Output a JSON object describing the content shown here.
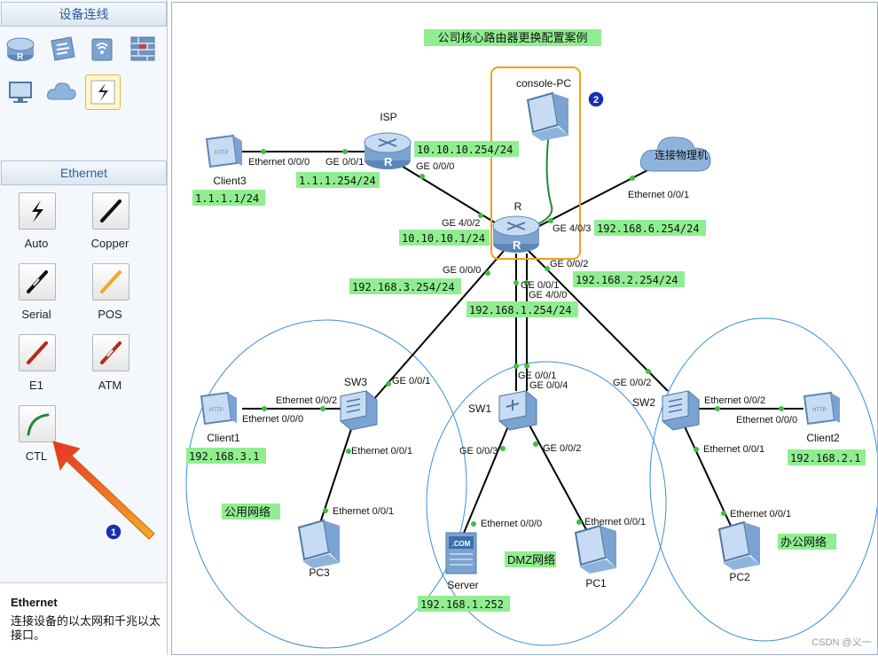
{
  "left_panel": {
    "devices_title": "设备连线",
    "ethernet_title": "Ethernet",
    "cables": [
      {
        "label": "Auto"
      },
      {
        "label": "Copper"
      },
      {
        "label": "Serial"
      },
      {
        "label": "POS"
      },
      {
        "label": "E1"
      },
      {
        "label": "ATM"
      },
      {
        "label": "CTL"
      }
    ],
    "info_title": "Ethernet",
    "info_text": "连接设备的以太网和千兆以太接口。"
  },
  "diagram": {
    "title": "公司核心路由器更换配置案例",
    "devices": {
      "console_pc": "console-PC",
      "isp": "ISP",
      "client3": "Client3",
      "cloud": "连接物理机",
      "r": "R",
      "sw3": "SW3",
      "sw1": "SW1",
      "sw2": "SW2",
      "client1": "Client1",
      "client2": "Client2",
      "pc3": "PC3",
      "server": "Server",
      "pc1": "PC1",
      "pc2": "PC2"
    },
    "ports": {
      "client3_eth": "Ethernet 0/0/0",
      "isp_ge001": "GE 0/0/1",
      "isp_ge000": "GE 0/0/0",
      "cloud_eth": "Ethernet 0/0/1",
      "r_ge402": "GE 4/0/2",
      "r_ge403": "GE 4/0/3",
      "r_ge000": "GE 0/0/0",
      "r_ge002": "GE 0/0/2",
      "r_ge001": "GE 0/0/1",
      "r_ge400": "GE 4/0/0",
      "sw3_ge001": "GE 0/0/1",
      "sw3_eth002": "Ethernet 0/0/2",
      "client1_eth": "Ethernet 0/0/0",
      "sw3_eth001": "Ethernet 0/0/1",
      "pc3_eth": "Ethernet 0/0/1",
      "sw1_ge001": "GE 0/0/1",
      "sw1_ge004": "GE 0/0/4",
      "sw1_ge003": "GE 0/0/3",
      "sw1_ge002": "GE 0/0/2",
      "server_eth": "Ethernet 0/0/0",
      "pc1_eth": "Ethernet 0/0/1",
      "sw2_ge002": "GE 0/0/2",
      "sw2_eth002": "Ethernet 0/0/2",
      "client2_eth": "Ethernet 0/0/0",
      "sw2_eth001": "Ethernet 0/0/1",
      "pc2_eth": "Ethernet 0/0/1"
    },
    "ips": {
      "isp_upper": "10.10.10.254/24",
      "isp_lower": "1.1.1.254/24",
      "client3": "1.1.1.1/24",
      "r_left": "10.10.10.1/24",
      "r_right": "192.168.6.254/24",
      "r_sw3": "192.168.3.254/24",
      "r_sw2": "192.168.2.254/24",
      "r_sw1": "192.168.1.254/24",
      "client1": "192.168.3.1",
      "client2": "192.168.2.1",
      "server": "192.168.1.252"
    },
    "zones": {
      "public": "公用网络",
      "dmz": "DMZ网络",
      "office": "办公网络"
    },
    "markers": {
      "one": "1",
      "two": "2"
    },
    "watermark": "CSDN @义一"
  },
  "colors": {
    "label_bg": "#90ee90",
    "link": "#000000",
    "console_link": "#1f8a3c",
    "port_dot": "#3fbf3f",
    "highlight_box": "#f0a020",
    "zone_circle": "#3a8fd8",
    "arrow": "#e03020",
    "marker": "#1a2fb0"
  }
}
